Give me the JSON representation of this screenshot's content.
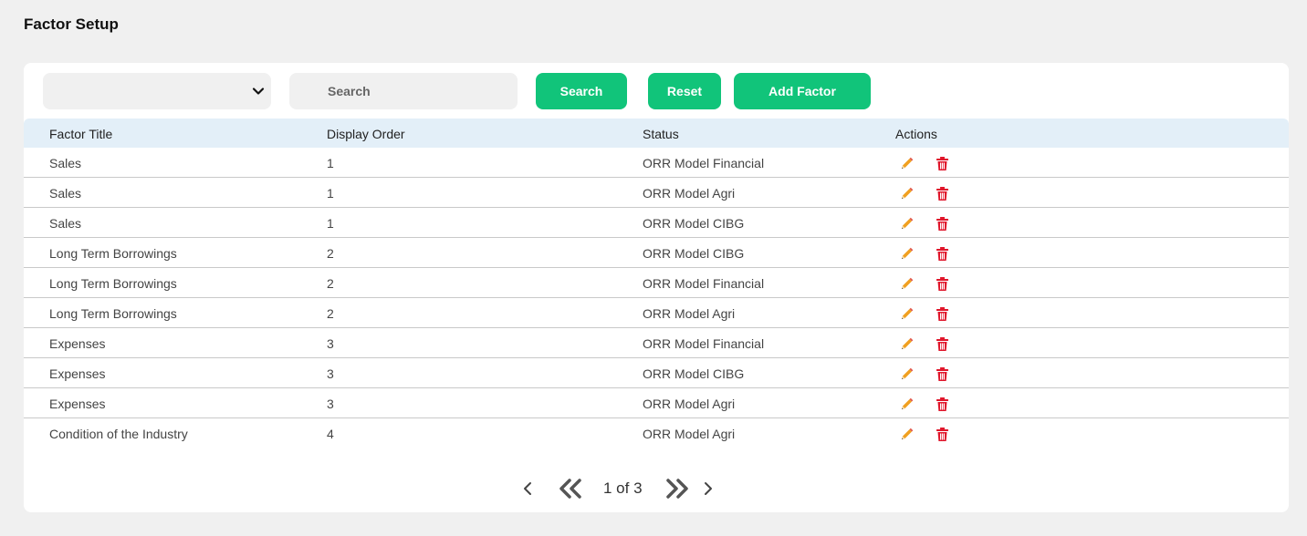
{
  "page": {
    "title": "Factor Setup"
  },
  "toolbar": {
    "select_value": "",
    "search_placeholder": "Search",
    "search_label": "Search",
    "reset_label": "Reset",
    "add_label": "Add Factor"
  },
  "table": {
    "headers": [
      "Factor Title",
      "Display Order",
      "Status",
      "Actions"
    ],
    "rows": [
      [
        "Sales",
        "1",
        "ORR Model Financial"
      ],
      [
        "Sales",
        "1",
        "ORR Model Agri"
      ],
      [
        "Sales",
        "1",
        "ORR Model CIBG"
      ],
      [
        "Long Term Borrowings",
        "2",
        "ORR Model CIBG"
      ],
      [
        "Long Term Borrowings",
        "2",
        "ORR Model Financial"
      ],
      [
        "Long Term Borrowings",
        "2",
        "ORR Model Agri"
      ],
      [
        "Expenses",
        "3",
        "ORR Model Financial"
      ],
      [
        "Expenses",
        "3",
        "ORR Model CIBG"
      ],
      [
        "Expenses",
        "3",
        "ORR Model Agri"
      ],
      [
        "Condition of the Industry",
        "4",
        "ORR Model Agri"
      ]
    ]
  },
  "pagination": {
    "info": "1 of 3"
  },
  "icons": {
    "edit": "pencil-icon",
    "delete": "trash-icon"
  },
  "colors": {
    "accent": "#11c47a",
    "header_bg": "#e3eff8",
    "delete": "#e0162b",
    "edit": "#f0a020"
  }
}
